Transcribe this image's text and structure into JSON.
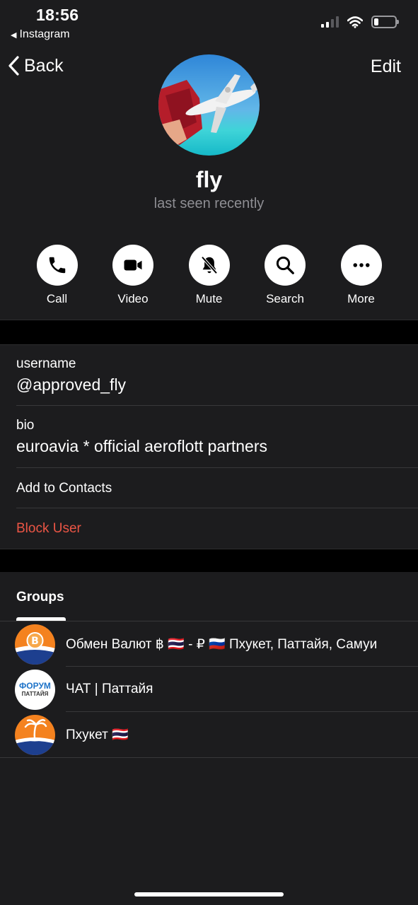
{
  "status_bar": {
    "time": "18:56",
    "back_app": "Instagram",
    "back_app_icon": "triangle-left-icon",
    "signal_bars_active": 2,
    "signal_bars_total": 4,
    "battery_level": 0.15
  },
  "nav": {
    "back_label": "Back",
    "edit_label": "Edit"
  },
  "profile": {
    "name": "fly",
    "status": "last seen recently",
    "avatar": "airplane-photo"
  },
  "actions": [
    {
      "label": "Call",
      "icon": "phone-icon"
    },
    {
      "label": "Video",
      "icon": "video-camera-icon"
    },
    {
      "label": "Mute",
      "icon": "bell-slash-icon"
    },
    {
      "label": "Search",
      "icon": "search-icon"
    },
    {
      "label": "More",
      "icon": "more-dots-icon"
    }
  ],
  "info": {
    "username_label": "username",
    "username_value": "@approved_fly",
    "bio_label": "bio",
    "bio_value": "euroavia * official aeroflott partners",
    "add_contacts": "Add to Contacts",
    "block_user": "Block User"
  },
  "groups": {
    "tab_label": "Groups",
    "items": [
      {
        "name": "Обмен Валют ฿ 🇹🇭 - ₽ 🇷🇺 Пхукет, Паттайя, Самуи",
        "avatar": "baht-exchange-logo"
      },
      {
        "name": "ЧАТ | Паттайя",
        "avatar_line1": "ФОРУМ",
        "avatar_line2": "ПАТТАЙЯ"
      },
      {
        "name": "Пхукет 🇹🇭",
        "avatar": "palm-island-logo"
      }
    ]
  },
  "colors": {
    "background": "#1c1c1e",
    "separator": "#000000",
    "destructive": "#eb5545",
    "secondary_text": "#8e8e93"
  }
}
